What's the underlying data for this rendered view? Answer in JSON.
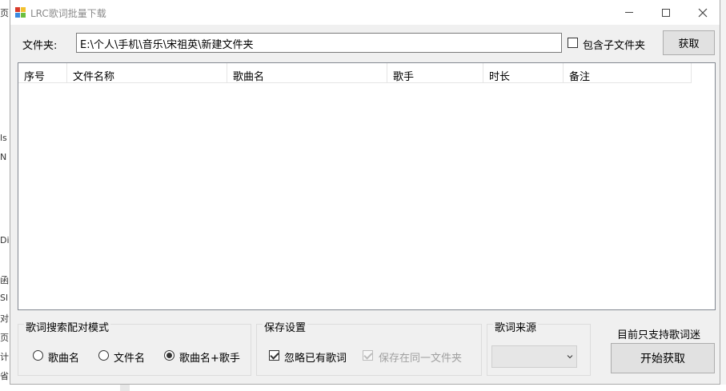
{
  "background": {
    "left_chars": [
      "页",
      "ls",
      "N",
      "Di",
      "函",
      "Sl",
      "对",
      "页",
      "计",
      "省"
    ]
  },
  "window": {
    "title": "LRC歌词批量下载"
  },
  "folder": {
    "label": "文件夹:",
    "path": "E:\\个人\\手机\\音乐\\宋祖英\\新建文件夹",
    "include_sub_label": "包含子文件夹",
    "include_sub_checked": false,
    "fetch_button": "获取"
  },
  "table": {
    "columns": [
      "序号",
      "文件名称",
      "歌曲名",
      "歌手",
      "时长",
      "备注"
    ],
    "rows": []
  },
  "search_mode": {
    "title": "歌词搜索配对模式",
    "options": [
      "歌曲名",
      "文件名",
      "歌曲名+歌手"
    ],
    "selected": "歌曲名+歌手"
  },
  "save": {
    "title": "保存设置",
    "ignore_label": "忽略已有歌词",
    "ignore_checked": true,
    "same_folder_label": "保存在同一文件夹",
    "same_folder_checked": true,
    "same_folder_enabled": false
  },
  "source": {
    "title": "歌词来源",
    "selected": ""
  },
  "note": "目前只支持歌词迷",
  "start_button": "开始获取"
}
